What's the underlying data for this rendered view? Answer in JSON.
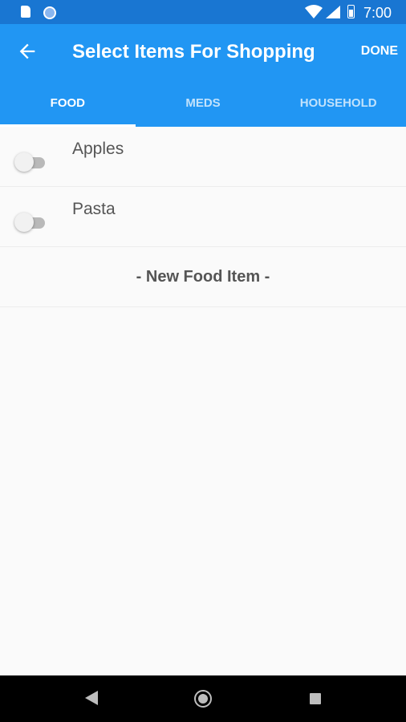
{
  "status_bar": {
    "time": "7:00",
    "icons": [
      "sd-card-icon",
      "sync-icon",
      "wifi-icon",
      "signal-icon",
      "battery-icon"
    ]
  },
  "app_bar": {
    "title": "Select Items For Shopping",
    "action_label": "DONE",
    "back_icon": "arrow-back-icon",
    "color": "#2196f3"
  },
  "tabs": [
    {
      "label": "FOOD",
      "active": true
    },
    {
      "label": "MEDS",
      "active": false
    },
    {
      "label": "HOUSEHOLD",
      "active": false
    }
  ],
  "items": [
    {
      "label": "Apples",
      "selected": false
    },
    {
      "label": "Pasta",
      "selected": false
    }
  ],
  "new_item_label": "- New Food Item -",
  "nav_bar": {
    "icons": [
      "nav-back-icon",
      "nav-home-icon",
      "nav-recents-icon"
    ]
  }
}
